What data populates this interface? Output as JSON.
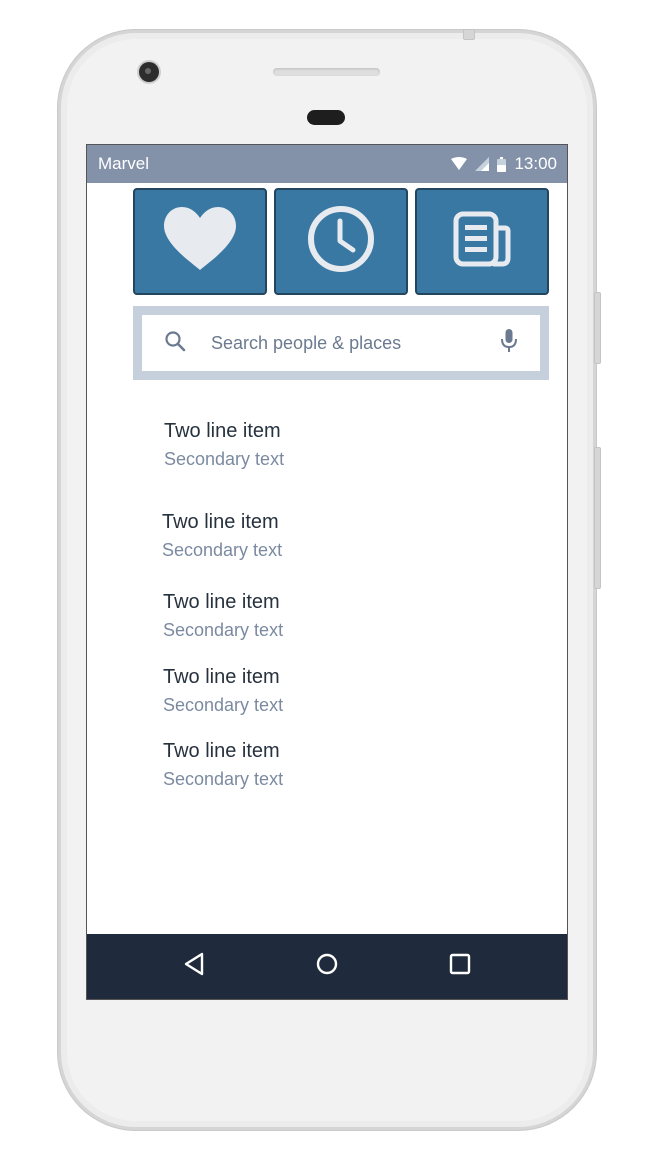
{
  "status_bar": {
    "app_name": "Marvel",
    "time": "13:00",
    "icons": [
      "wifi-icon",
      "signal-icon",
      "battery-icon"
    ]
  },
  "tiles": [
    {
      "icon": "heart-icon"
    },
    {
      "icon": "clock-icon"
    },
    {
      "icon": "news-icon"
    }
  ],
  "search": {
    "placeholder": "Search people & places",
    "left_icon": "search-icon",
    "right_icon": "mic-icon"
  },
  "list": {
    "items": [
      {
        "primary": "Two line item",
        "secondary": "Secondary text"
      },
      {
        "primary": "Two line item",
        "secondary": "Secondary text"
      },
      {
        "primary": "Two line item",
        "secondary": "Secondary text"
      },
      {
        "primary": "Two line item",
        "secondary": "Secondary text"
      },
      {
        "primary": "Two line item",
        "secondary": "Secondary text"
      }
    ]
  },
  "nav_bar": {
    "buttons": [
      "back-icon",
      "home-icon",
      "recents-icon"
    ]
  },
  "colors": {
    "status_bar": "#8392a9",
    "tile": "#3a78a4",
    "search_frame": "#c6d0dd",
    "nav_bar": "#1f2b3c",
    "primary_text": "#27323f",
    "secondary_text": "#7b8aa1"
  }
}
